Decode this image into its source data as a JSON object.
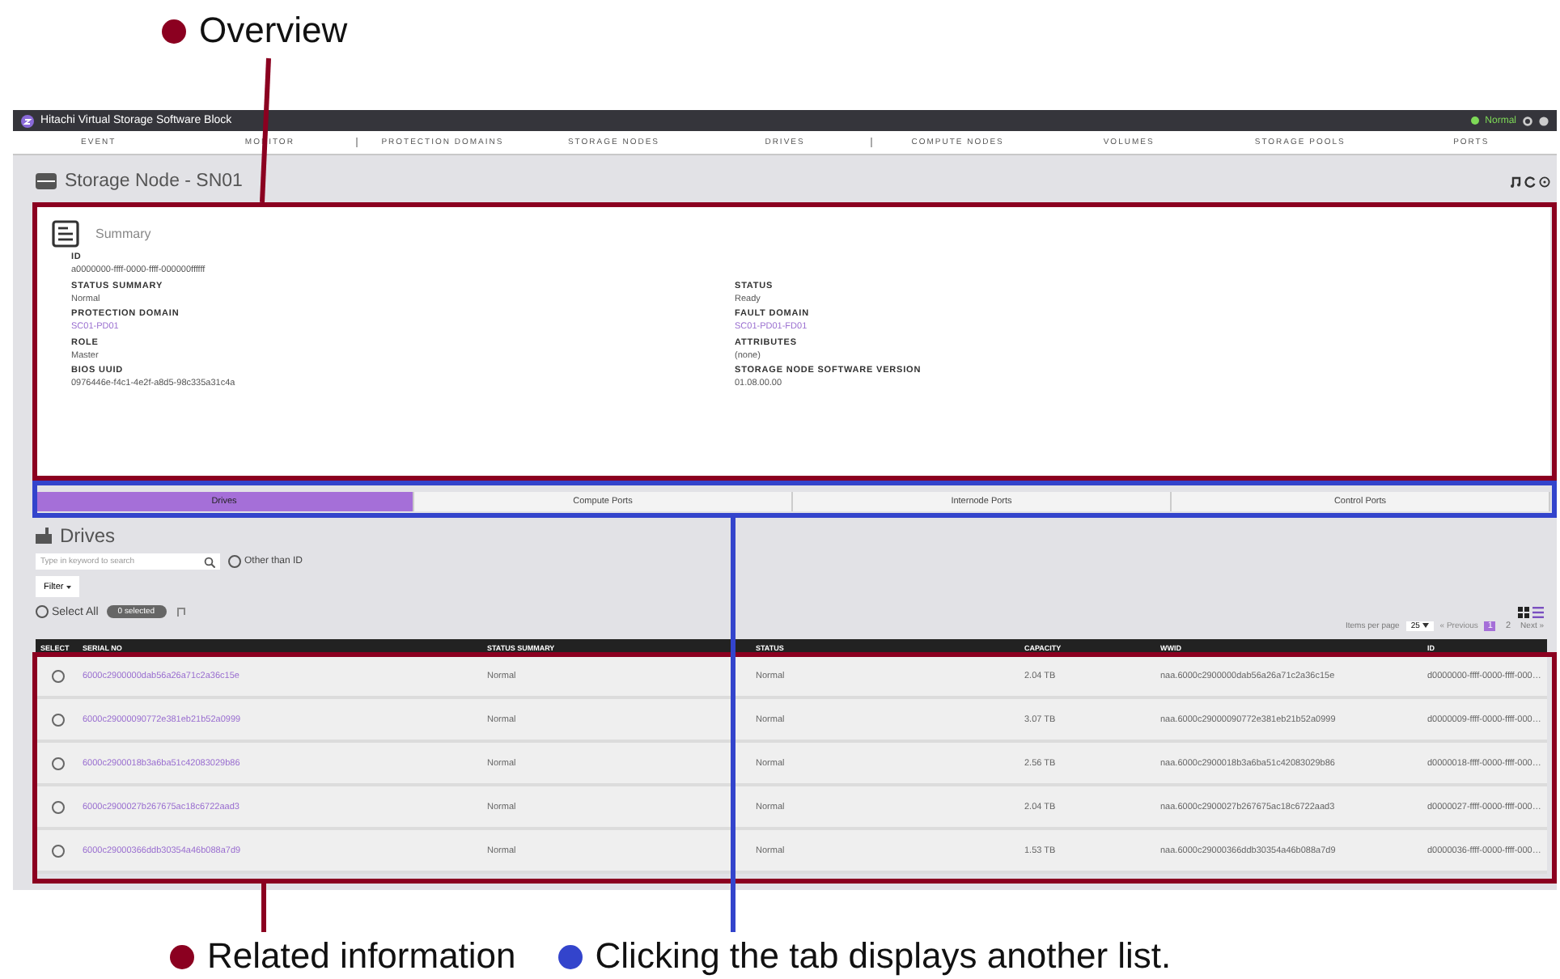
{
  "callouts": [
    {
      "kind": "top",
      "text": "Overview",
      "color": "#8b0020"
    },
    {
      "kind": "bottom",
      "text": "Related information",
      "color": "#8b0020"
    },
    {
      "kind": "bottom",
      "text": "Clicking the tab displays another list.",
      "color": "#3344cc"
    }
  ],
  "app": {
    "title": "Hitachi Virtual Storage Software Block",
    "status": "Normal",
    "nav": [
      "EVENT",
      "MONITOR",
      "PROTECTION DOMAINS",
      "STORAGE NODES",
      "DRIVES",
      "COMPUTE NODES",
      "VOLUMES",
      "STORAGE POOLS",
      "PORTS"
    ],
    "page_title": "Storage Node - SN01",
    "summary": {
      "title": "Summary",
      "left": [
        {
          "label": "ID",
          "value": "a0000000-ffff-0000-ffff-000000ffffff",
          "kind": "text"
        },
        {
          "label": "STATUS SUMMARY",
          "value": "Normal",
          "kind": "text"
        },
        {
          "label": "PROTECTION DOMAIN",
          "value": "SC01-PD01",
          "kind": "link"
        },
        {
          "label": "ROLE",
          "value": "Master",
          "kind": "text"
        },
        {
          "label": "BIOS UUID",
          "value": "0976446e-f4c1-4e2f-a8d5-98c335a31c4a",
          "kind": "text"
        }
      ],
      "right": [
        {
          "label": "STATUS",
          "value": "Ready",
          "kind": "text"
        },
        {
          "label": "FAULT DOMAIN",
          "value": "SC01-PD01-FD01",
          "kind": "link"
        },
        {
          "label": "ATTRIBUTES",
          "value": "(none)",
          "kind": "text"
        },
        {
          "label": "STORAGE NODE SOFTWARE VERSION",
          "value": "01.08.00.00",
          "kind": "text"
        }
      ]
    },
    "tabs": [
      {
        "label": "Drives",
        "selected": true
      },
      {
        "label": "Compute Ports",
        "selected": false
      },
      {
        "label": "Internode Ports",
        "selected": false
      },
      {
        "label": "Control Ports",
        "selected": false
      }
    ],
    "list": {
      "title": "Drives",
      "search_placeholder": "Type in keyword to search",
      "other_than_id": {
        "label": "Other than ID",
        "checked": false
      },
      "filter": "Filter",
      "select_all": {
        "label": "Select All",
        "checked": false
      },
      "selected_badge": "0 selected",
      "items_per_page_label": "Items per page",
      "items_per_page": "25",
      "previous": "« Previous",
      "pages": [
        {
          "label": "1",
          "selected": true
        },
        {
          "label": "2",
          "selected": false
        }
      ],
      "next": "Next »"
    },
    "table": {
      "select_header": "SELECT",
      "columns": [
        "SERIAL NO",
        "STATUS SUMMARY",
        "STATUS",
        "CAPACITY",
        "WWID",
        "ID"
      ],
      "rows": [
        {
          "selected": false,
          "cells": [
            "6000c2900000dab56a26a71c2a36c15e",
            "Normal",
            "Normal",
            "2.04 TB",
            "naa.6000c2900000dab56a26a71c2a36c15e",
            "d0000000-ffff-0000-ffff-000…"
          ]
        },
        {
          "selected": false,
          "cells": [
            "6000c29000090772e381eb21b52a0999",
            "Normal",
            "Normal",
            "3.07 TB",
            "naa.6000c29000090772e381eb21b52a0999",
            "d0000009-ffff-0000-ffff-000…"
          ]
        },
        {
          "selected": false,
          "cells": [
            "6000c2900018b3a6ba51c42083029b86",
            "Normal",
            "Normal",
            "2.56 TB",
            "naa.6000c2900018b3a6ba51c42083029b86",
            "d0000018-ffff-0000-ffff-000…"
          ]
        },
        {
          "selected": false,
          "cells": [
            "6000c2900027b267675ac18c6722aad3",
            "Normal",
            "Normal",
            "2.04 TB",
            "naa.6000c2900027b267675ac18c6722aad3",
            "d0000027-ffff-0000-ffff-000…"
          ]
        },
        {
          "selected": false,
          "cells": [
            "6000c29000366ddb30354a46b088a7d9",
            "Normal",
            "Normal",
            "1.53 TB",
            "naa.6000c29000366ddb30354a46b088a7d9",
            "d0000036-ffff-0000-ffff-000…"
          ]
        }
      ]
    }
  }
}
